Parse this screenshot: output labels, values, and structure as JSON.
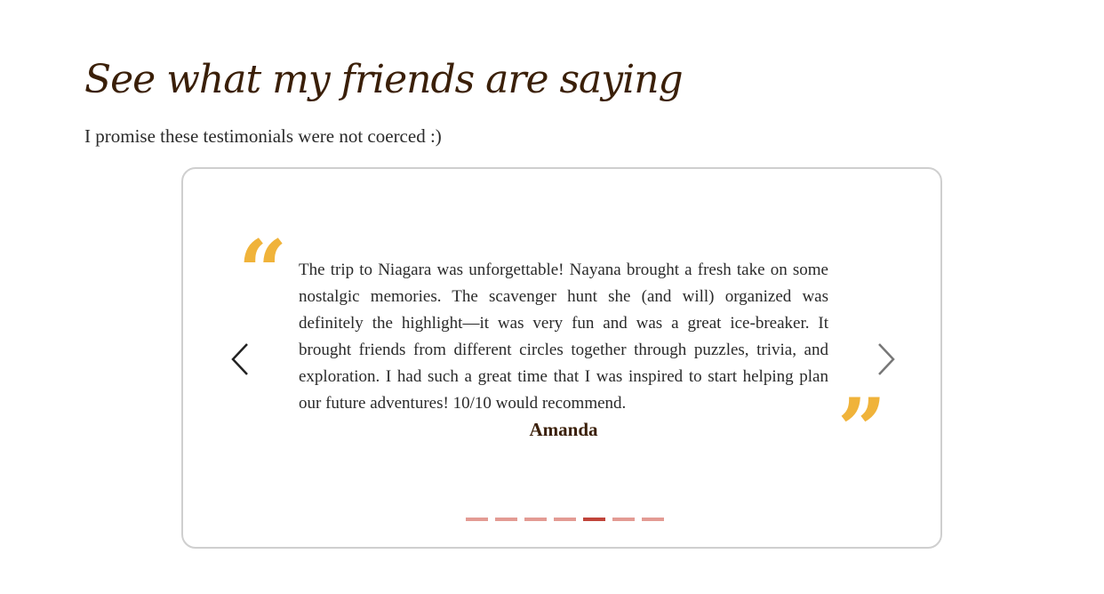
{
  "section": {
    "title": "See what my friends are saying",
    "subtitle": "I promise these testimonials were not coerced :)"
  },
  "carousel": {
    "open_quote_glyph": "“",
    "close_quote_glyph": "”",
    "quote": "The trip to Niagara was unforgettable! Nayana brought a fresh take on some nostalgic memories. The scavenger hunt she (and will) organized was definitely the highlight—it was very fun and was a great ice-breaker. It brought friends from different circles together through puzzles, trivia, and exploration. I had such a great time that I was inspired to start helping plan our future adventures! 10/10 would recommend.",
    "author": "Amanda",
    "prev_icon": "chevron-left-icon",
    "next_icon": "chevron-right-icon",
    "slide_count": 7,
    "active_slide": 5
  },
  "colors": {
    "heading": "#3a1f08",
    "quote_mark": "#f0b33a",
    "indicator": "#e39b94",
    "indicator_active": "#c0443a",
    "card_border": "#cfcfcf"
  }
}
